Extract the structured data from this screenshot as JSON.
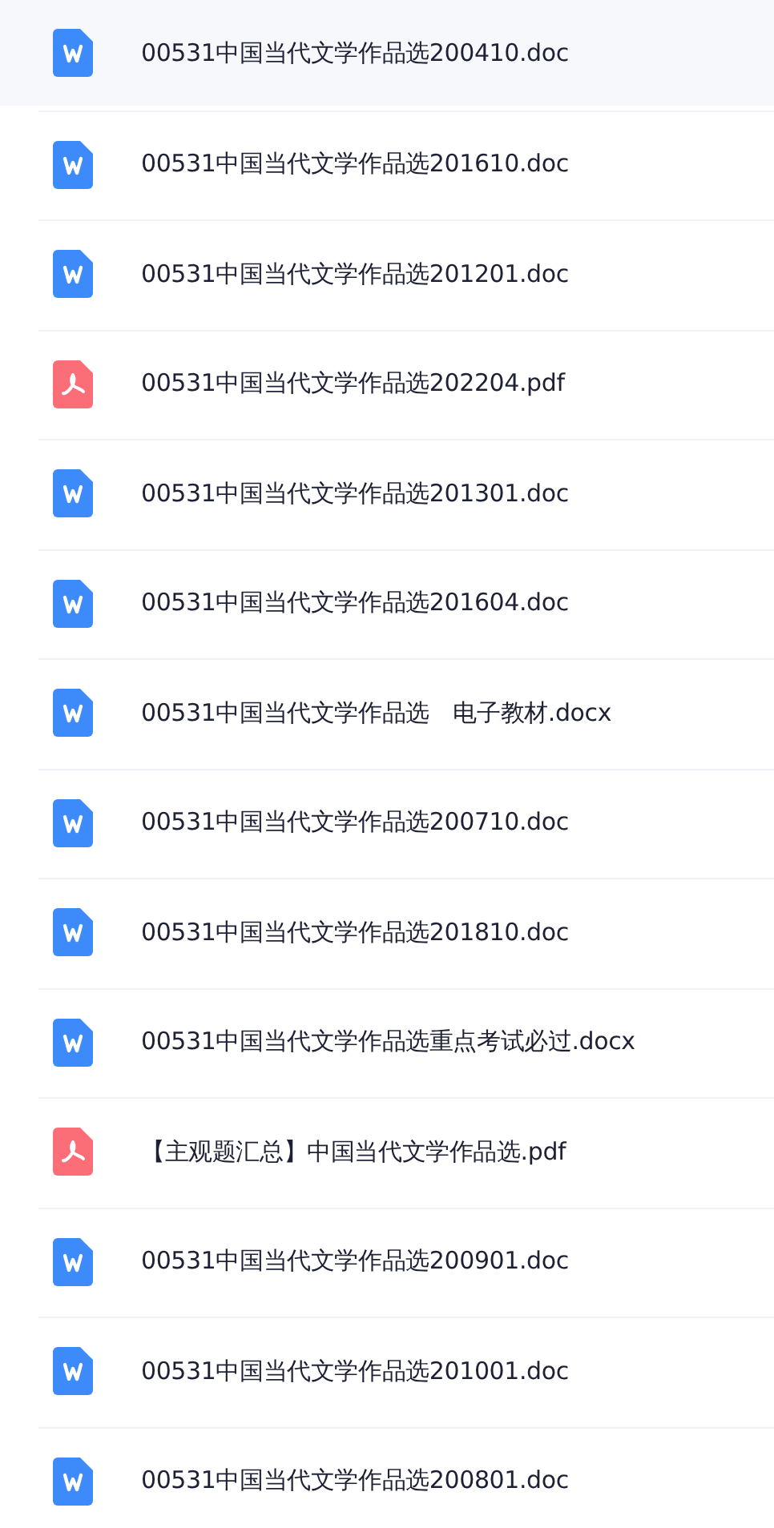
{
  "files": [
    {
      "name": "00531中国当代文学作品选200410.doc",
      "kind": "word",
      "selected": true
    },
    {
      "name": "00531中国当代文学作品选201610.doc",
      "kind": "word",
      "selected": false
    },
    {
      "name": "00531中国当代文学作品选201201.doc",
      "kind": "word",
      "selected": false
    },
    {
      "name": "00531中国当代文学作品选202204.pdf",
      "kind": "pdf",
      "selected": false
    },
    {
      "name": "00531中国当代文学作品选201301.doc",
      "kind": "word",
      "selected": false
    },
    {
      "name": "00531中国当代文学作品选201604.doc",
      "kind": "word",
      "selected": false
    },
    {
      "name": "00531中国当代文学作品选　电子教材.docx",
      "kind": "word",
      "selected": false
    },
    {
      "name": "00531中国当代文学作品选200710.doc",
      "kind": "word",
      "selected": false
    },
    {
      "name": "00531中国当代文学作品选201810.doc",
      "kind": "word",
      "selected": false
    },
    {
      "name": "00531中国当代文学作品选重点考试必过.docx",
      "kind": "word",
      "selected": false
    },
    {
      "name": "【主观题汇总】中国当代文学作品选.pdf",
      "kind": "pdf",
      "selected": false
    },
    {
      "name": "00531中国当代文学作品选200901.doc",
      "kind": "word",
      "selected": false
    },
    {
      "name": "00531中国当代文学作品选201001.doc",
      "kind": "word",
      "selected": false
    },
    {
      "name": "00531中国当代文学作品选200801.doc",
      "kind": "word",
      "selected": false
    }
  ]
}
